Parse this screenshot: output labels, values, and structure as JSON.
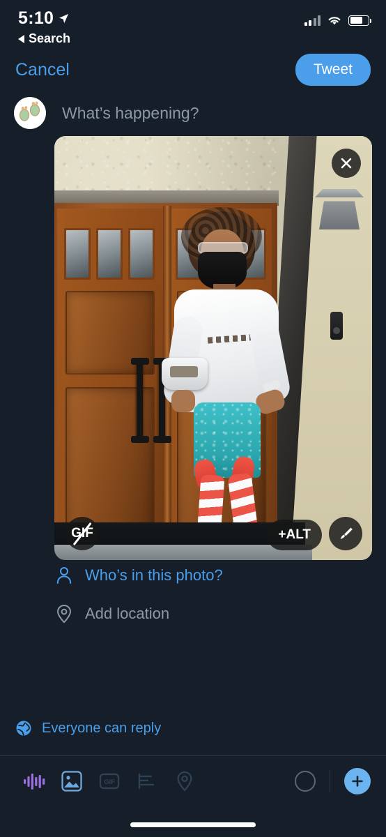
{
  "status_bar": {
    "time": "5:10",
    "location_icon": "location-arrow-icon",
    "back_label": "Search",
    "cellular_icon": "cellular-bars-icon",
    "cellular_bars_filled": 2,
    "wifi_icon": "wifi-icon",
    "battery_icon": "battery-icon",
    "battery_level": 70
  },
  "navbar": {
    "cancel_label": "Cancel",
    "tweet_label": "Tweet",
    "accent_color": "#4a9eea"
  },
  "compose": {
    "avatar_name": "user-avatar",
    "placeholder": "What’s happening?"
  },
  "media": {
    "alt_badge_label": "+ALT",
    "gif_label": "GIF",
    "close_icon": "close-icon",
    "edit_icon": "paintbrush-icon",
    "description": "Person wearing a black face mask, sunglasses, white long-sleeve shirt and teal patterned leggings with red-and-white striped stockings and white sneakers, standing in front of wooden double doors"
  },
  "options": [
    {
      "icon": "person-icon",
      "label": "Who’s in this photo?",
      "color": "#4a9eea"
    },
    {
      "icon": "location-pin-icon",
      "label": "Add location",
      "color": "#8b98a5"
    }
  ],
  "reply_settings": {
    "icon": "globe-icon",
    "label": "Everyone can reply",
    "color": "#4a9eea"
  },
  "toolbar": {
    "items": [
      {
        "name": "audio-waveform-icon",
        "label": "Audio",
        "state": "enabled",
        "color": "#9b6fe0"
      },
      {
        "name": "image-icon",
        "label": "Photo",
        "state": "active",
        "color": "#6fa8dc"
      },
      {
        "name": "gif-icon",
        "label": "GIF",
        "state": "disabled",
        "color": "#2f4356"
      },
      {
        "name": "poll-icon",
        "label": "Poll",
        "state": "disabled",
        "color": "#2f4356"
      },
      {
        "name": "location-icon",
        "label": "Location",
        "state": "disabled",
        "color": "#2f4356"
      }
    ],
    "gif_label": "GIF",
    "char_count_ring": "character-count-ring",
    "add_label": "+"
  },
  "theme": {
    "background": "#161f29",
    "accent": "#4a9eea",
    "muted_text": "#8b98a5"
  }
}
